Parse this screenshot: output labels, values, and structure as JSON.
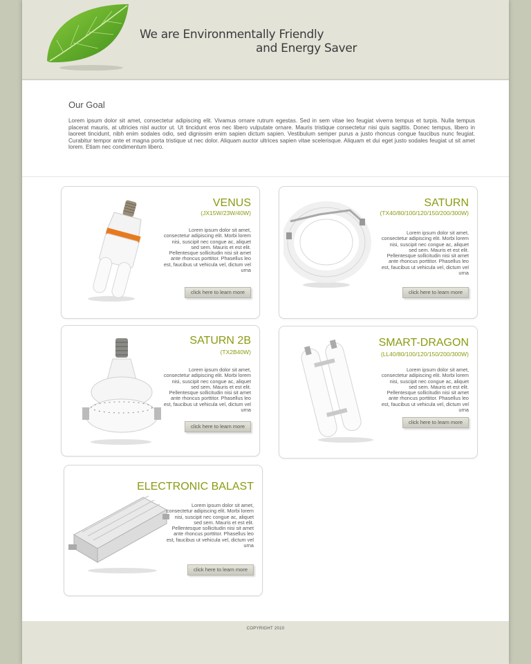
{
  "header": {
    "tagline_line1": "We are Environmentally Friendly",
    "tagline_line2": "and Energy Saver"
  },
  "goal": {
    "title": "Our Goal",
    "text": "Lorem ipsum dolor sit amet, consectetur adipiscing elit. Vivamus ornare rutrum egestas. Sed in sem vitae leo feugiat viverra tempus et turpis. Nulla tempus placerat mauris, at ultricies nisl auctor ut. Ut tincidunt eros nec libero vulputate ornare. Mauris tristique consectetur nisi quis sagittis. Donec tempus, libero in laoreet tincidunt, nibh enim sodales odio, sed dignissim enim sapien dictum sapien. Vestibulum semper purus a justo rhoncus congue faucibus nunc feugiat. Curabitur tempor ante et magna porta tristique ut nec dolor. Aliquam auctor ultrices sapien vitae scelerisque. Aliquam et dui eget justo sodales feugiat ut sit amet lorem. Etiam nec condimentum libero."
  },
  "products": [
    {
      "name": "VENUS",
      "spec": "(JX15W/23W/40W)",
      "description": "Lorem ipsum dolor sit amet, consectetur adipiscing elit. Morbi lorem nisi, suscipit nec congue ac, aliquet sed sem. Mauris et est elit. Pellentesque sollicitudin nisi sit amet ante rhoncus porttitor. Phasellus leo est, faucibus ut vehicula vel, dictum vel urna",
      "button": "click here to learn more"
    },
    {
      "name": "SATURN",
      "spec": "(TX40/80/100/120/150/200/300W)",
      "description": "Lorem ipsum dolor sit amet, consectetur adipiscing elit. Morbi lorem nisi, suscipit nec congue ac, aliquet sed sem. Mauris et est elit. Pellentesque sollicitudin nisi sit amet ante rhoncus porttitor. Phasellus leo est, faucibus ut vehicula vel, dictum vel urna",
      "button": "click here to learn more"
    },
    {
      "name": "SATURN 2B",
      "spec": "(TX2B40W)",
      "description": "Lorem ipsum dolor sit amet, consectetur adipiscing elit. Morbi lorem nisi, suscipit nec congue ac, aliquet sed sem. Mauris et est elit. Pellentesque sollicitudin nisi sit amet ante rhoncus porttitor. Phasellus leo est, faucibus ut vehicula vel, dictum vel urna",
      "button": "click here to learn more"
    },
    {
      "name": "SMART-DRAGON",
      "spec": "(LL40/80/100/120/150/200/300W)",
      "description": "Lorem ipsum dolor sit amet, consectetur adipiscing elit. Morbi lorem nisi, suscipit nec congue ac, aliquet sed sem. Mauris et est elit. Pellentesque sollicitudin nisi sit amet ante rhoncus porttitor. Phasellus leo est, faucibus ut vehicula vel, dictum vel urna",
      "button": "click here to learn more"
    },
    {
      "name": "ELECTRONIC BALAST",
      "description": "Lorem ipsum dolor sit amet, consectetur adipiscing elit. Morbi lorem nisi, suscipit nec congue ac, aliquet sed sem. Mauris et est elit. Pellentesque sollicitudin nisi sit amet ante rhoncus porttitor. Phasellus leo est, faucibus ut vehicula vel, dictum vel urna",
      "button": "click here to learn more"
    }
  ],
  "footer": {
    "copyright": "COPYRIGHT 2010"
  },
  "colors": {
    "accent": "#8c9a10",
    "background": "#c6c9b6",
    "header": "#e3e3d8"
  }
}
